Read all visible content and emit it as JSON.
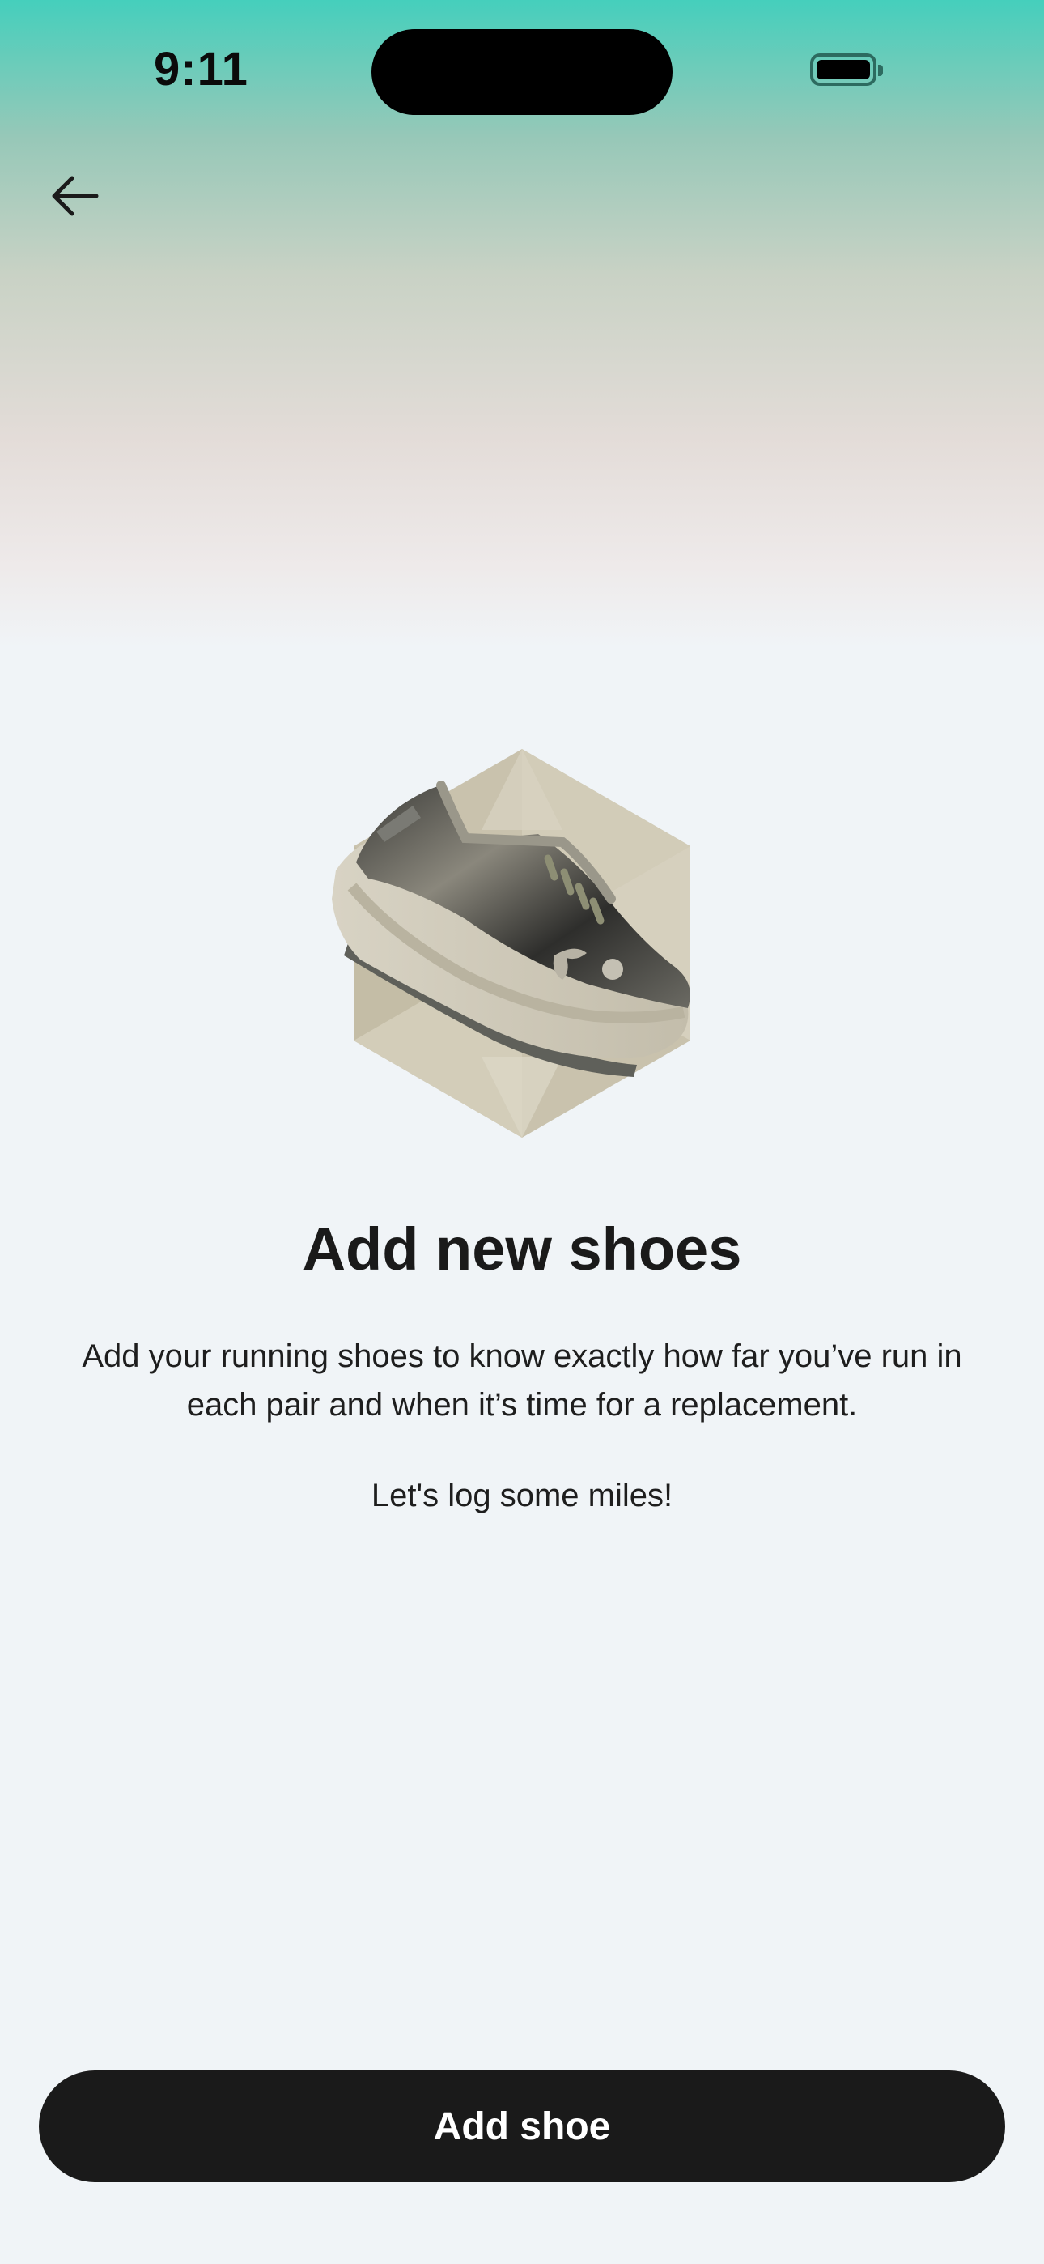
{
  "status_bar": {
    "time": "9:11",
    "battery_icon": "battery-full-icon"
  },
  "nav": {
    "back_icon": "arrow-left-icon"
  },
  "hero": {
    "illustration": "running-shoe-illustration"
  },
  "content": {
    "title": "Add new shoes",
    "description": "Add your running shoes to know exactly how far you’ve run in each pair and when it’s time for a replacement.",
    "cta_text": "Let's log some miles!"
  },
  "actions": {
    "add_shoe_label": "Add shoe"
  },
  "colors": {
    "header_top": "#45cfbc",
    "background": "#f0f4f7",
    "button": "#1a1a1a",
    "button_text": "#ffffff"
  }
}
